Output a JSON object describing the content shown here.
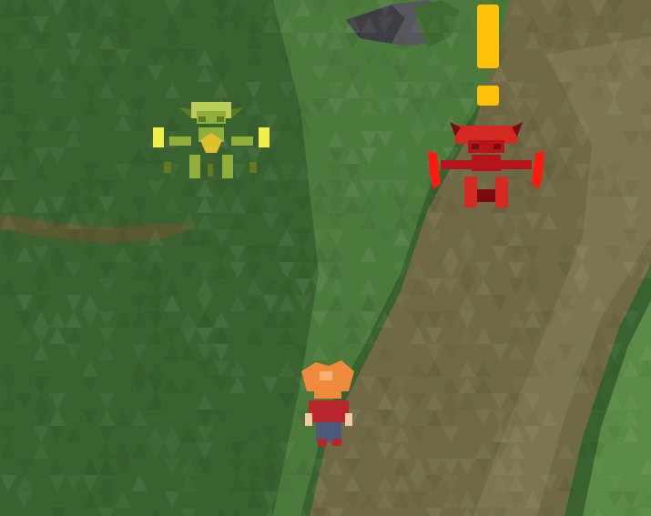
{
  "scene": {
    "terrain": {
      "grass_dark": "#3a6230",
      "grass_mid": "#4c7a3c",
      "grass_light": "#5a8a45",
      "path_color": "#6f6a45",
      "path_light": "#7b7550",
      "rock_color": "#3e3e44",
      "rock_light": "#56565e"
    },
    "entities": [
      {
        "kind": "goblin",
        "color_body": "#8fae3a",
        "color_light": "#b9cf5a",
        "color_dark": "#5f7a22",
        "color_glow": "#f3ef4a",
        "color_belly": "#e0c02a",
        "alerted": false
      },
      {
        "kind": "demon",
        "color_body": "#b5151a",
        "color_light": "#d42a22",
        "color_dark": "#7a0c10",
        "color_glow": "#ff1a10",
        "alerted": true
      },
      {
        "kind": "player",
        "color_hair": "#f08a3c",
        "color_hair_light": "#ffb070",
        "color_shirt": "#b8262c",
        "color_skin": "#f2c9a0",
        "color_pants": "#4a5a7a"
      }
    ],
    "alert_marker": {
      "symbol": "!",
      "color": "#ffc20a"
    }
  }
}
